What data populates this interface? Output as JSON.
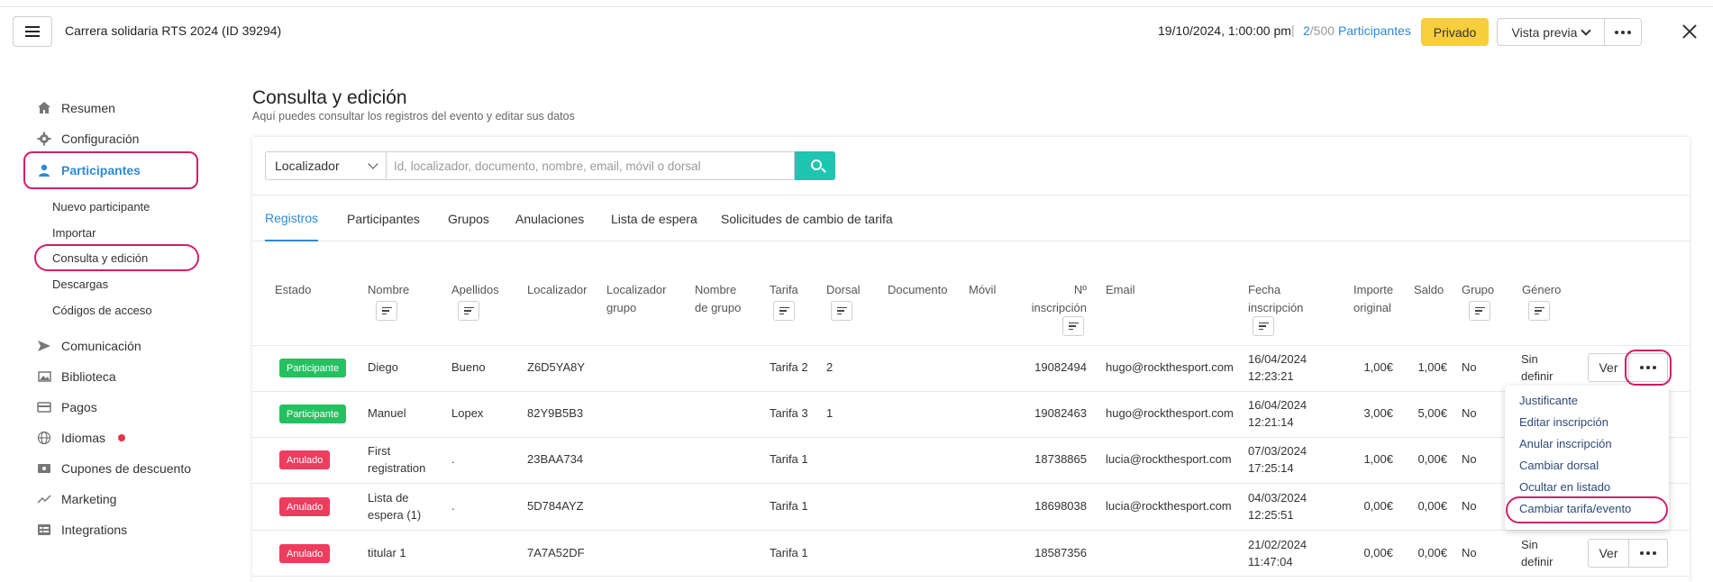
{
  "header": {
    "event_title": "Carrera solidaria RTS 2024 (ID 39294)",
    "event_date": "19/10/2024, 1:00:00 pm",
    "separator": "|",
    "participants_count": "2",
    "participants_max": "/500",
    "participants_label": "Participantes",
    "privacy_label": "Privado",
    "preview_label": "Vista previa"
  },
  "sidebar": {
    "items": [
      {
        "label": "Resumen",
        "icon": "home-icon"
      },
      {
        "label": "Configuración",
        "icon": "gear-icon"
      },
      {
        "label": "Participantes",
        "icon": "user-icon"
      },
      {
        "label": "Comunicación",
        "icon": "send-icon"
      },
      {
        "label": "Biblioteca",
        "icon": "images-icon"
      },
      {
        "label": "Pagos",
        "icon": "card-icon"
      },
      {
        "label": "Idiomas",
        "icon": "globe-icon"
      },
      {
        "label": "Cupones de descuento",
        "icon": "ticket-icon"
      },
      {
        "label": "Marketing",
        "icon": "chart-icon"
      },
      {
        "label": "Integrations",
        "icon": "list-icon"
      }
    ],
    "sub_items": [
      "Nuevo participante",
      "Importar",
      "Consulta y edición",
      "Descargas",
      "Códigos de acceso"
    ]
  },
  "main": {
    "title": "Consulta y edición",
    "subtitle": "Aquí puedes consultar los registros del evento y editar sus datos",
    "search": {
      "selected": "Localizador",
      "placeholder": "Id, localizador, documento, nombre, email, móvil o dorsal"
    },
    "tabs": [
      "Registros",
      "Participantes",
      "Grupos",
      "Anulaciones",
      "Lista de espera",
      "Solicitudes de cambio de tarifa"
    ]
  },
  "table": {
    "headers": {
      "estado": "Estado",
      "nombre": "Nombre",
      "apellidos": "Apellidos",
      "localizador": "Localizador",
      "loc_grupo_1": "Localizador",
      "loc_grupo_2": "grupo",
      "nombre_grupo_1": "Nombre",
      "nombre_grupo_2": "de grupo",
      "tarifa": "Tarifa",
      "dorsal": "Dorsal",
      "documento": "Documento",
      "movil": "Móvil",
      "inscripcion_1": "Nº",
      "inscripcion_2": "inscripción",
      "email": "Email",
      "fecha_1": "Fecha",
      "fecha_2": "inscripción",
      "importe_1": "Importe",
      "importe_2": "original",
      "saldo": "Saldo",
      "grupo": "Grupo",
      "genero": "Género"
    },
    "rows": [
      {
        "estado": "Participante",
        "nombre_1": "Diego",
        "nombre_2": "",
        "apellidos": "Bueno",
        "localizador": "Z6D5YA8Y",
        "tarifa": "Tarifa 2",
        "dorsal": "2",
        "inscripcion": "19082494",
        "email": "hugo@rockthesport.com",
        "fecha_1": "16/04/2024",
        "fecha_2": "12:23:21",
        "importe": "1,00€",
        "saldo": "1,00€",
        "grupo": "No",
        "genero_1": "Sin",
        "genero_2": "definir"
      },
      {
        "estado": "Participante",
        "nombre_1": "Manuel",
        "nombre_2": "",
        "apellidos": "Lopex",
        "localizador": "82Y9B5B3",
        "tarifa": "Tarifa 3",
        "dorsal": "1",
        "inscripcion": "19082463",
        "email": "hugo@rockthesport.com",
        "fecha_1": "16/04/2024",
        "fecha_2": "12:21:14",
        "importe": "3,00€",
        "saldo": "5,00€",
        "grupo": "No",
        "genero_1": "",
        "genero_2": ""
      },
      {
        "estado": "Anulado",
        "nombre_1": "First",
        "nombre_2": "registration",
        "apellidos": ".",
        "localizador": "23BAA734",
        "tarifa": "Tarifa 1",
        "dorsal": "",
        "inscripcion": "18738865",
        "email": "lucia@rockthesport.com",
        "fecha_1": "07/03/2024",
        "fecha_2": "17:25:14",
        "importe": "1,00€",
        "saldo": "0,00€",
        "grupo": "No",
        "genero_1": "",
        "genero_2": ""
      },
      {
        "estado": "Anulado",
        "nombre_1": "Lista de",
        "nombre_2": "espera (1)",
        "apellidos": ".",
        "localizador": "5D784AYZ",
        "tarifa": "Tarifa 1",
        "dorsal": "",
        "inscripcion": "18698038",
        "email": "lucia@rockthesport.com",
        "fecha_1": "04/03/2024",
        "fecha_2": "12:25:51",
        "importe": "0,00€",
        "saldo": "0,00€",
        "grupo": "No",
        "genero_1": "",
        "genero_2": ""
      },
      {
        "estado": "Anulado",
        "nombre_1": "titular 1",
        "nombre_2": "",
        "apellidos": "",
        "localizador": "7A7A52DF",
        "tarifa": "Tarifa 1",
        "dorsal": "",
        "inscripcion": "18587356",
        "email": "",
        "fecha_1": "21/02/2024",
        "fecha_2": "11:47:04",
        "importe": "0,00€",
        "saldo": "0,00€",
        "grupo": "No",
        "genero_1": "Sin",
        "genero_2": "definir"
      }
    ],
    "ver_label": "Ver"
  },
  "dropdown": {
    "items": [
      "Justificante",
      "Editar inscripción",
      "Anular inscripción",
      "Cambiar dorsal",
      "Ocultar en listado",
      "Cambiar tarifa/evento"
    ]
  },
  "colors": {
    "accent": "#2d8ad8",
    "highlight": "#d21f68",
    "search_button": "#1cc6b1",
    "badge_participant": "#26c061",
    "badge_cancelled": "#ec3d5f",
    "privacy_badge": "#f7cf3c"
  }
}
